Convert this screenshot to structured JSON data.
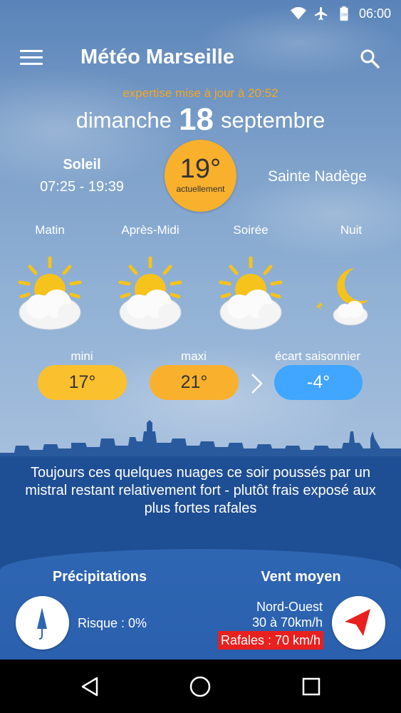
{
  "status_bar": {
    "icons": [
      "wifi-icon",
      "airplane-icon",
      "battery-icon"
    ],
    "battery_level": "100",
    "time": "06:00"
  },
  "app_bar": {
    "title": "Météo Marseille",
    "menu_icon": "menu-icon",
    "search_icon": "search-icon"
  },
  "header": {
    "update_text": "expertise mise à jour à 20:52",
    "day_name": "dimanche",
    "day_number": "18",
    "month": "septembre"
  },
  "sun": {
    "label": "Soleil",
    "times": "07:25 - 19:39"
  },
  "current": {
    "temperature": "19°",
    "label": "actuellement"
  },
  "saint": "Sainte Nadège",
  "periods": [
    {
      "label": "Matin",
      "icon": "sun-cloud-icon"
    },
    {
      "label": "Après-Midi",
      "icon": "sun-cloud-icon"
    },
    {
      "label": "Soirée",
      "icon": "sun-cloud-icon"
    },
    {
      "label": "Nuit",
      "icon": "moon-cloud-icon"
    }
  ],
  "temps": {
    "min_label": "mini",
    "min_value": "17°",
    "max_label": "maxi",
    "max_value": "21°",
    "gap_label": "écart saisonnier",
    "gap_value": "-4°"
  },
  "forecast_text": "Toujours ces quelques nuages ce soir poussés par un mistral restant relativement fort - plutôt frais exposé aux plus fortes rafales",
  "precipitation": {
    "title": "Précipitations",
    "risk": "Risque : 0%",
    "icon": "umbrella-icon"
  },
  "wind": {
    "title": "Vent moyen",
    "direction": "Nord-Ouest",
    "speed": "30 à 70km/h",
    "gusts": "Rafales : 70 km/h",
    "icon": "wind-arrow-icon"
  },
  "nav_bar": {
    "icons": [
      "back-icon",
      "home-icon",
      "recents-icon"
    ]
  },
  "colors": {
    "accent_orange": "#f9b02d",
    "update_text": "#f5a623",
    "seasonal_blue": "#40a6ff",
    "gusts_red": "#e8201e",
    "wind_arrow_red": "#e8201e"
  }
}
